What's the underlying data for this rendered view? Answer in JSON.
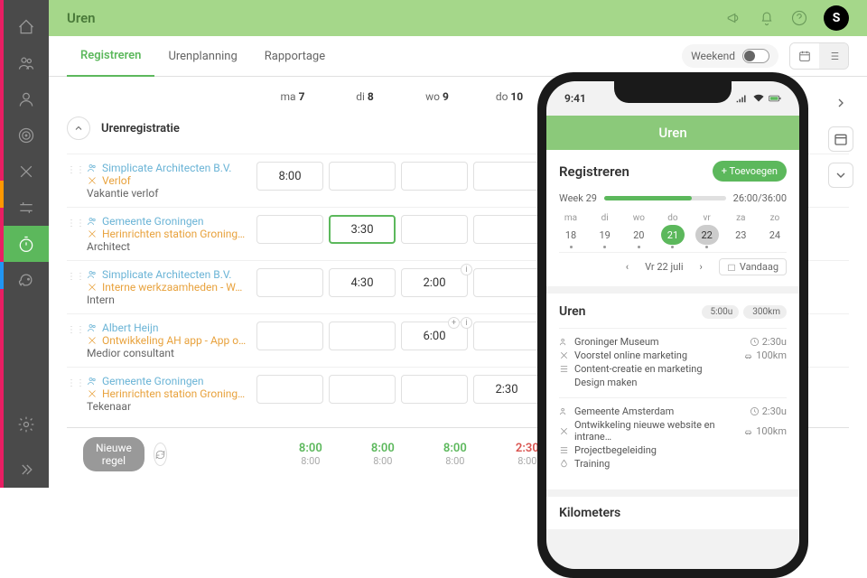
{
  "colors": {
    "accent": "#5cb85c",
    "header": "#a5d78a",
    "sidebar": "#4a4a4a"
  },
  "header": {
    "title": "Uren"
  },
  "tabs": {
    "items": [
      "Registreren",
      "Urenplanning",
      "Rapportage"
    ],
    "activeIndex": 0,
    "weekendLabel": "Weekend"
  },
  "dayHeader": [
    {
      "abbr": "ma",
      "num": "7"
    },
    {
      "abbr": "di",
      "num": "8"
    },
    {
      "abbr": "wo",
      "num": "9"
    },
    {
      "abbr": "do",
      "num": "10"
    }
  ],
  "section": {
    "title": "Urenregistratie"
  },
  "rows": [
    {
      "client": "Simplicate Architecten B.V.",
      "project": "Verlof",
      "role": "Vakantie verlof",
      "cells": [
        "8:00",
        "",
        "",
        ""
      ]
    },
    {
      "client": "Gemeente Groningen",
      "project": "Herinrichten station Groning…",
      "role": "Architect",
      "cells": [
        "",
        "3:30",
        "",
        ""
      ],
      "highlight": 1
    },
    {
      "client": "Simplicate Architecten B.V.",
      "project": "Interne werkzaamheden - W…",
      "role": "Intern",
      "cells": [
        "",
        "4:30",
        "2:00",
        ""
      ],
      "badge2": "i"
    },
    {
      "client": "Albert Heijn",
      "project": "Ontwikkeling AH app - App o…",
      "role": "Medior consultant",
      "cells": [
        "",
        "",
        "6:00",
        ""
      ],
      "badge2": "i",
      "badge2b": "+"
    },
    {
      "client": "Gemeente Groningen",
      "project": "Herinrichten station Groning…",
      "role": "Tekenaar",
      "cells": [
        "",
        "",
        "",
        "2:30"
      ]
    }
  ],
  "newRowLabel": "Nieuwe regel",
  "totals": [
    {
      "main": "8:00",
      "sub": "8:00"
    },
    {
      "main": "8:00",
      "sub": "8:00"
    },
    {
      "main": "8:00",
      "sub": "8:00"
    },
    {
      "main": "2:30",
      "sub": "8:00",
      "red": true
    }
  ],
  "phone": {
    "statusTime": "9:41",
    "title": "Uren",
    "registerTitle": "Registreren",
    "addLabel": "+ Toevoegen",
    "weekLabel": "Week 29",
    "weekTotal": "26:00/36:00",
    "dayAbbrs": [
      "ma",
      "di",
      "wo",
      "do",
      "vr",
      "za",
      "zo"
    ],
    "dates": [
      "18",
      "19",
      "20",
      "21",
      "22",
      "23",
      "24"
    ],
    "selectedIndex": 3,
    "highlightedIndex": 4,
    "dateNavLabel": "Vr 22 juli",
    "todayLabel": "Vandaag",
    "urenTitle": "Uren",
    "badges": [
      {
        "icon": "clock",
        "text": "5:00u"
      },
      {
        "icon": "car",
        "text": "300km"
      }
    ],
    "entries": [
      {
        "client": "Groninger Museum",
        "meta": [
          {
            "icon": "clock",
            "text": "2:30u"
          },
          {
            "icon": "car",
            "text": "100km"
          }
        ],
        "lines": [
          {
            "icon": "tool",
            "text": "Voorstel online marketing"
          },
          {
            "icon": "list",
            "text": "Content-creatie en marketing"
          },
          {
            "icon": "blank",
            "text": "Design maken"
          }
        ]
      },
      {
        "client": "Gemeente Amsterdam",
        "meta": [
          {
            "icon": "clock",
            "text": "2:30u"
          },
          {
            "icon": "car",
            "text": "100km"
          }
        ],
        "lines": [
          {
            "icon": "tool",
            "text": "Ontwikkeling nieuwe website en intrane…"
          },
          {
            "icon": "list",
            "text": "Projectbegeleiding"
          },
          {
            "icon": "drop",
            "text": "Training"
          }
        ]
      }
    ],
    "kmTitle": "Kilometers"
  }
}
